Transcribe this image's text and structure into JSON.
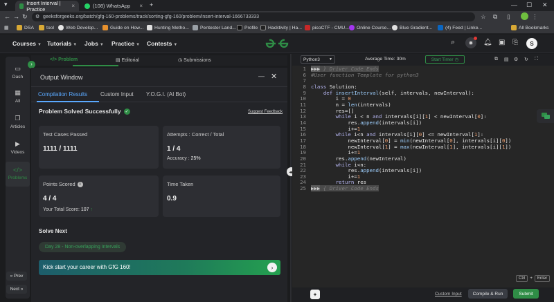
{
  "browser": {
    "tabs": [
      {
        "title": "Insert Interval | Practice",
        "active": true
      },
      {
        "title": "(108) WhatsApp",
        "active": false
      }
    ],
    "new_tab": "+",
    "url": "geeksforgeeks.org/batch/gfg-160-problems/track/sorting-gfg-160/problem/insert-interval-1666733333",
    "bookmarks": [
      "DSA",
      "tool",
      "Web Develop...",
      "Guide on How...",
      "Hunting Metho...",
      "Pentester Land...",
      "Profile",
      "Hacktivity | Ha...",
      "picoCTF - CMU...",
      "Online Course...",
      "Blue Gradient...",
      "(4) Feed | Linke..."
    ],
    "all_bookmarks": "All Bookmarks"
  },
  "site_nav": {
    "items": [
      "Courses",
      "Tutorials",
      "Jobs",
      "Practice",
      "Contests"
    ],
    "avatar_letter": "S"
  },
  "sidebar": {
    "items": [
      "Dash",
      "All",
      "Articles",
      "Videos",
      "Problems"
    ],
    "prev": "« Prev",
    "next": "Next »"
  },
  "panel_tabs": [
    "Problem",
    "Editorial",
    "Submissions"
  ],
  "output": {
    "title": "Output Window",
    "tabs": [
      "Compilation Results",
      "Custom Input",
      "Y.O.G.I. (AI Bot)"
    ],
    "status": "Problem Solved Successfully",
    "feedback": "Suggest Feedback",
    "cards": {
      "test_cases_label": "Test Cases Passed",
      "test_cases_value": "1111 / 1111",
      "attempts_label": "Attempts : Correct / Total",
      "attempts_value": "1 / 4",
      "accuracy_label": "Accuracy : ",
      "accuracy_value": "25%",
      "points_label": "Points Scored",
      "points_value": "4 / 4",
      "total_score_label": "Your Total Score: ",
      "total_score_value": "107",
      "time_label": "Time Taken",
      "time_value": "0.9"
    },
    "solve_next": "Solve Next",
    "next_problem": "Day 28 - Non-overlapping Intervals",
    "banner": "Kick start your career with GfG 160!"
  },
  "editor": {
    "language": "Python3",
    "avg_time": "Average Time: 30m",
    "start_timer": "Start Timer",
    "custom_input": "Custom Input",
    "compile_run": "Compile & Run",
    "submit": "Submit",
    "shortcut_ctrl": "Ctrl",
    "shortcut_plus": "+",
    "shortcut_enter": "Enter"
  },
  "colors": {
    "accent_green": "#2f8d46",
    "link_blue": "#5aa9ff",
    "panel_bg": "#232428",
    "card_bg": "#2d2e33"
  }
}
